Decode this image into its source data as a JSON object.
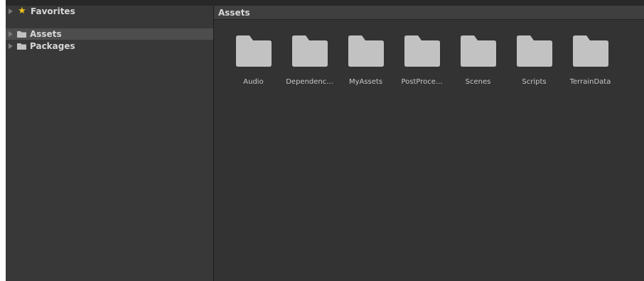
{
  "colors": {
    "folder_fill": "#c2c2c2",
    "favorite_star": "#f0c419",
    "selection": "#4d4d4d",
    "text": "#d6d6d6"
  },
  "sidebar": {
    "items": [
      {
        "label": "Favorites",
        "icon": "star-icon",
        "selected": false
      },
      {
        "label": "Assets",
        "icon": "folder-icon",
        "selected": true
      },
      {
        "label": "Packages",
        "icon": "folder-icon",
        "selected": false
      }
    ]
  },
  "main": {
    "breadcrumb": "Assets",
    "folders": [
      {
        "label": "Audio"
      },
      {
        "label": "Dependenc..."
      },
      {
        "label": "MyAssets"
      },
      {
        "label": "PostProce..."
      },
      {
        "label": "Scenes"
      },
      {
        "label": "Scripts"
      },
      {
        "label": "TerrainData"
      }
    ]
  }
}
